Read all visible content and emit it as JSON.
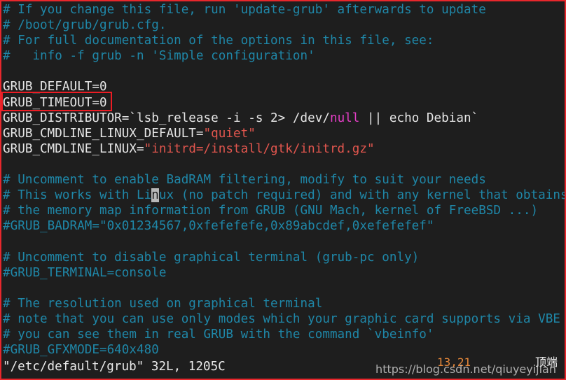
{
  "window": {
    "background_color": "#1e1e1e",
    "border_color": "#e8272c"
  },
  "editor": {
    "name": "vim",
    "comment_color": "#1f87a8",
    "string_color": "#e2564e",
    "plain_color": "#e6e6e6",
    "magenta_color": "#e23ec4",
    "cursor_color": "#b8b8b8",
    "lines": [
      {
        "id": "l1",
        "segments": [
          {
            "text": "# If you change this file, run 'update-grub' afterwards to update",
            "cls": "c-comment"
          }
        ]
      },
      {
        "id": "l2",
        "segments": [
          {
            "text": "# /boot/grub/grub.cfg.",
            "cls": "c-comment"
          }
        ]
      },
      {
        "id": "l3",
        "segments": [
          {
            "text": "# For full documentation of the options in this file, see:",
            "cls": "c-comment"
          }
        ]
      },
      {
        "id": "l4",
        "segments": [
          {
            "text": "#   info -f grub -n 'Simple configuration'",
            "cls": "c-comment"
          }
        ]
      },
      {
        "id": "l5",
        "segments": [
          {
            "text": "",
            "cls": "c-comment"
          }
        ]
      },
      {
        "id": "l6",
        "segments": [
          {
            "text": "GRUB_DEFAULT=0",
            "cls": "c-plain"
          }
        ]
      },
      {
        "id": "l7",
        "segments": [
          {
            "text": "GRUB_TIMEOUT=0",
            "cls": "c-plain"
          }
        ]
      },
      {
        "id": "l8",
        "segments": [
          {
            "text": "GRUB_DISTRIBUTOR=`lsb_release -i -s 2> /dev/",
            "cls": "c-plain"
          },
          {
            "text": "null",
            "cls": "c-magenta"
          },
          {
            "text": " || echo Debian`",
            "cls": "c-plain"
          }
        ]
      },
      {
        "id": "l9",
        "segments": [
          {
            "text": "GRUB_CMDLINE_LINUX_DEFAULT=",
            "cls": "c-plain"
          },
          {
            "text": "\"quiet\"",
            "cls": "c-string"
          }
        ]
      },
      {
        "id": "l10",
        "segments": [
          {
            "text": "GRUB_CMDLINE_LINUX=",
            "cls": "c-plain"
          },
          {
            "text": "\"initrd=/install/gtk/initrd.gz\"",
            "cls": "c-string"
          }
        ]
      },
      {
        "id": "l11",
        "segments": [
          {
            "text": "",
            "cls": "c-comment"
          }
        ]
      },
      {
        "id": "l12",
        "segments": [
          {
            "text": "# Uncomment to enable BadRAM filtering, modify to suit your needs",
            "cls": "c-comment"
          }
        ]
      },
      {
        "id": "l13",
        "segments": [
          {
            "text": "# This works with Li",
            "cls": "c-comment"
          },
          {
            "text": "n",
            "cls": "c-comment cursor"
          },
          {
            "text": "ux (no patch required) and with any kernel that obtains",
            "cls": "c-comment"
          }
        ]
      },
      {
        "id": "l14",
        "segments": [
          {
            "text": "# the memory map information from GRUB (GNU Mach, kernel of FreeBSD ...)",
            "cls": "c-comment"
          }
        ]
      },
      {
        "id": "l15",
        "segments": [
          {
            "text": "#GRUB_BADRAM=\"0x01234567,0xfefefefe,0x89abcdef,0xefefefef\"",
            "cls": "c-comment"
          }
        ]
      },
      {
        "id": "l16",
        "segments": [
          {
            "text": "",
            "cls": "c-comment"
          }
        ]
      },
      {
        "id": "l17",
        "segments": [
          {
            "text": "# Uncomment to disable graphical terminal (grub-pc only)",
            "cls": "c-comment"
          }
        ]
      },
      {
        "id": "l18",
        "segments": [
          {
            "text": "#GRUB_TERMINAL=console",
            "cls": "c-comment"
          }
        ]
      },
      {
        "id": "l19",
        "segments": [
          {
            "text": "",
            "cls": "c-comment"
          }
        ]
      },
      {
        "id": "l20",
        "segments": [
          {
            "text": "# The resolution used on graphical terminal",
            "cls": "c-comment"
          }
        ]
      },
      {
        "id": "l21",
        "segments": [
          {
            "text": "# note that you can use only modes which your graphic card supports via VBE",
            "cls": "c-comment"
          }
        ]
      },
      {
        "id": "l22",
        "segments": [
          {
            "text": "# you can see them in real GRUB with the command `vbeinfo'",
            "cls": "c-comment"
          }
        ]
      },
      {
        "id": "l23",
        "segments": [
          {
            "text": "#GRUB_GFXMODE=640x480",
            "cls": "c-comment"
          }
        ]
      }
    ]
  },
  "statusline": {
    "file_info": "\"/etc/default/grub\" 32L, 1205C",
    "cursor_position": "13,21",
    "scroll_indicator": "顶端",
    "position_color": "#e8893a"
  },
  "annotations": {
    "timeout_highlight": {
      "label": "GRUB_TIMEOUT=0",
      "color": "#ec1c24"
    }
  },
  "watermark": {
    "text": "https://blog.csdn.net/qiuyeyijian"
  }
}
